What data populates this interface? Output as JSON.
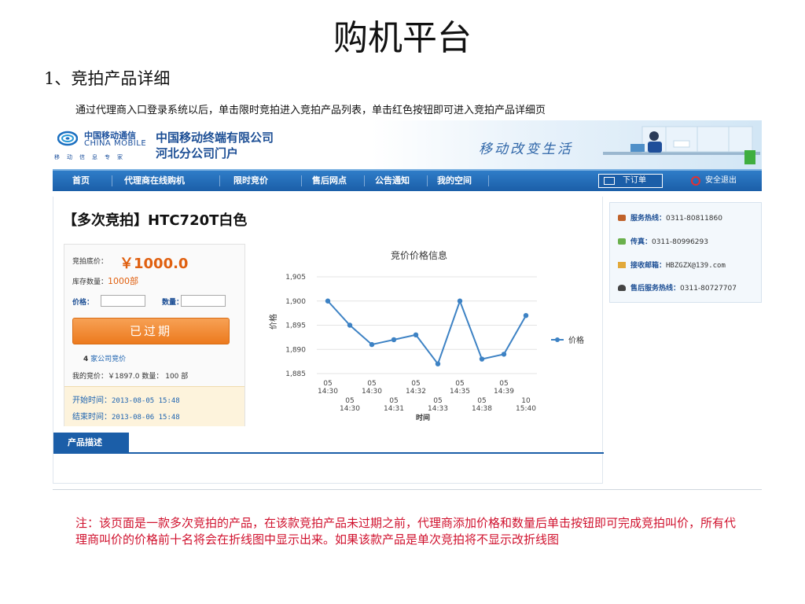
{
  "slide": {
    "title": "购机平台",
    "section": "1、竞拍产品详细",
    "intro": "通过代理商入口登录系统以后，单击限时竞拍进入竞拍产品列表，单击红色按钮即可进入竞拍产品详细页",
    "note": "注：该页面是一款多次竞拍的产品，在该款竞拍产品未过期之前，代理商添加价格和数量后单击按钮即可完成竞拍叫价，所有代理商叫价的价格前十名将会在折线图中显示出来。如果该款产品是单次竞拍将不显示改折线图"
  },
  "banner": {
    "logo_cn": "中国移动通信",
    "logo_en": "CHINA MOBILE",
    "logo_sub": "移动信息专家",
    "company_line1": "中国移动终端有限公司",
    "company_line2": "河北分公司门户",
    "slogan": "移动改变生活"
  },
  "nav": {
    "items": [
      "首页",
      "代理商在线购机",
      "限时竞价",
      "售后网点",
      "公告通知",
      "我的空间"
    ],
    "order_label": "下订单",
    "logout_label": "安全退出"
  },
  "product": {
    "title": "【多次竞拍】HTC720T白色",
    "base_price_label": "竞拍底价：",
    "base_price": "￥1000.0",
    "stock_label": "库存数量：",
    "stock_value": "1000部",
    "price_field_label": "价格：",
    "qty_field_label": "数量：",
    "expired_button": "已过期",
    "companies_count": "4",
    "companies_label": "家公司竞价",
    "my_bid": "我的竞价：￥1897.0   数量：     100 部",
    "start_label": "开始时间：",
    "start_time": "2013-08-05 15:48",
    "end_label": "结束时间：",
    "end_time": "2013-08-06 15:48",
    "desc_tab": "产品描述"
  },
  "sidebar": {
    "service_label": "服务热线：",
    "service_value": "0311-80811860",
    "fax_label": "传真：",
    "fax_value": "0311-80996293",
    "email_label": "接收邮箱：",
    "email_value": "HBZGZX@139.com",
    "aftersale_label": "售后服务热线：",
    "aftersale_value": "0311-80727707"
  },
  "chart_data": {
    "type": "line",
    "title": "竞价价格信息",
    "xlabel": "时间",
    "ylabel": "价格",
    "legend": "right",
    "x_top": [
      "05\n14:30",
      "05\n14:30",
      "05\n14:32",
      "05\n14:35",
      "05\n14:39"
    ],
    "x_bottom": [
      "05\n14:30",
      "05\n14:31",
      "05\n14:33",
      "05\n14:38",
      "10\n15:40"
    ],
    "categories": [
      "05 14:30",
      "05 14:30",
      "05 14:30",
      "05 14:31",
      "05 14:32",
      "05 14:33",
      "05 14:35",
      "05 14:38",
      "05 14:39",
      "10 15:40"
    ],
    "series": [
      {
        "name": "价格",
        "values": [
          1900,
          1895,
          1891,
          1892,
          1893,
          1887,
          1900,
          1888,
          1889,
          1897
        ],
        "color": "#3d82c4"
      }
    ],
    "yticks": [
      "1,885",
      "1,890",
      "1,895",
      "1,900",
      "1,905"
    ],
    "ylim": [
      1885,
      1905
    ]
  }
}
